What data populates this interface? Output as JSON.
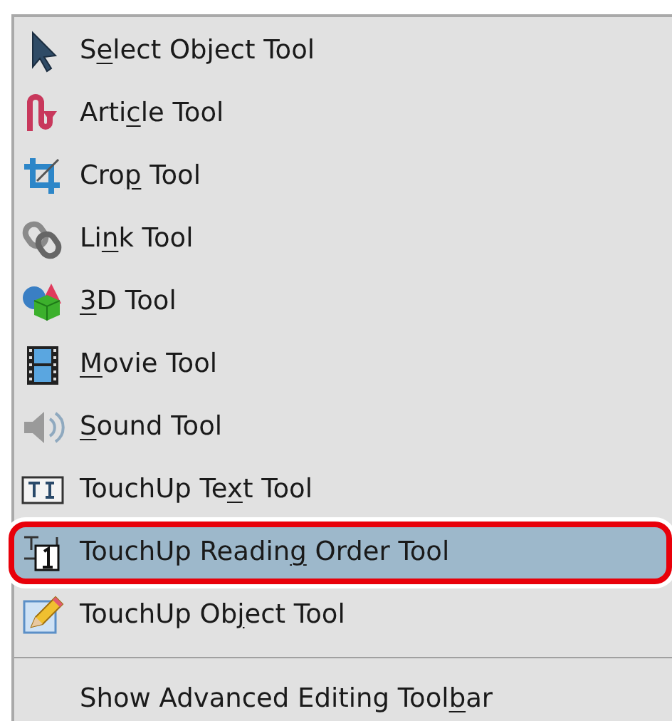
{
  "menu": {
    "items": [
      {
        "kind": "item",
        "label_start": "S",
        "access_key": "e",
        "label_end": "lect Object Tool",
        "selected": false
      },
      {
        "kind": "item",
        "label_start": "Arti",
        "access_key": "c",
        "label_end": "le Tool",
        "selected": false
      },
      {
        "kind": "item",
        "label_start": "Cro",
        "access_key": "p",
        "label_end": " Tool",
        "selected": false
      },
      {
        "kind": "item",
        "label_start": "Li",
        "access_key": "n",
        "label_end": "k Tool",
        "selected": false
      },
      {
        "kind": "item",
        "access_key": "3",
        "label_end": "D Tool",
        "selected": false
      },
      {
        "kind": "item",
        "access_key": "M",
        "label_end": "ovie Tool",
        "selected": false
      },
      {
        "kind": "item",
        "access_key": "S",
        "label_end": "ound Tool",
        "selected": false
      },
      {
        "kind": "item",
        "label_start": "TouchUp Te",
        "access_key": "x",
        "label_end": "t Tool",
        "selected": false
      },
      {
        "kind": "item",
        "label_start": "TouchUp Readin",
        "access_key": "g",
        "label_end": " Order Tool",
        "selected": true
      },
      {
        "kind": "item",
        "label_start": "TouchUp Ob",
        "access_key": "j",
        "label_end": "ect Tool",
        "selected": false
      },
      {
        "kind": "separator"
      },
      {
        "kind": "item",
        "label_start": "Show Advanced Editing Tool",
        "access_key": "b",
        "label_end": "ar",
        "selected": false
      }
    ]
  }
}
